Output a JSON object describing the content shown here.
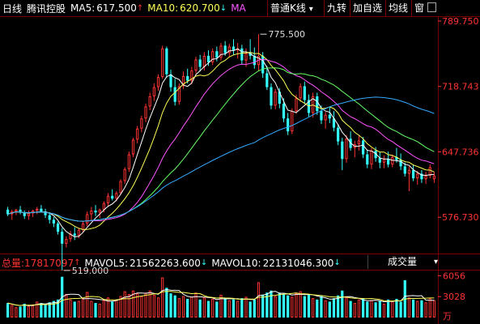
{
  "header": {
    "period": "日线",
    "stock_name": "腾讯控股",
    "ma5_label": "MA5:",
    "ma5_value": "617.500",
    "ma5_arrow": "↑",
    "ma10_label": "MA10:",
    "ma10_value": "620.700",
    "ma10_arrow": "↓",
    "ma_more": "MA"
  },
  "toolbar": {
    "kline_type": "普通K线",
    "kline_arrow": "▾",
    "nine_turn": "九转",
    "add_watch": "加自选",
    "avg_line": "均线",
    "window": "窗"
  },
  "volume_header": {
    "total_label": "总量:",
    "total_value": "17817097",
    "total_arrow": "↑",
    "mavol5_label": "MAVOL5:",
    "mavol5_value": "21562263.600",
    "mavol5_arrow": "↓",
    "mavol10_label": "MAVOL10:",
    "mavol10_value": "22131046.300",
    "mavol10_arrow": "↓",
    "indicator_select": "成交量",
    "indicator_arrow": "▾"
  },
  "colors": {
    "up": "#ff3333",
    "down": "#33ffff",
    "axis_text": "#ff3333",
    "ma5": "#ffffff",
    "ma10": "#ffff55",
    "ma20": "#ff55ff",
    "ma30": "#66ff66",
    "ma60": "#33aaff",
    "grid": "#7a0000"
  },
  "chart_data": {
    "type": "candlestick",
    "y_ticks": [
      "789.750",
      "718.743",
      "647.736",
      "576.730"
    ],
    "ylim": [
      540.0,
      795.0
    ],
    "volume_ticks": [
      "6056",
      "3028"
    ],
    "volume_unit": "万",
    "volume_ylim": [
      0,
      6800
    ],
    "annotations": [
      {
        "text": "775.500",
        "index": 60,
        "price": 775.5
      },
      {
        "text": "519.000",
        "index": 13,
        "price": 519.0
      }
    ],
    "candles": [
      [
        585,
        588,
        578,
        580
      ],
      [
        580,
        585,
        574,
        583
      ],
      [
        583,
        586,
        579,
        585
      ],
      [
        585,
        589,
        580,
        582
      ],
      [
        582,
        584,
        575,
        578
      ],
      [
        578,
        584,
        574,
        581
      ],
      [
        581,
        585,
        577,
        584
      ],
      [
        584,
        588,
        580,
        586
      ],
      [
        586,
        590,
        582,
        583
      ],
      [
        583,
        586,
        576,
        579
      ],
      [
        579,
        582,
        570,
        574
      ],
      [
        574,
        577,
        566,
        570
      ],
      [
        570,
        572,
        558,
        561
      ],
      [
        561,
        565,
        519,
        548
      ],
      [
        548,
        556,
        544,
        553
      ],
      [
        553,
        562,
        550,
        559
      ],
      [
        559,
        566,
        552,
        557
      ],
      [
        557,
        565,
        554,
        563
      ],
      [
        563,
        572,
        560,
        570
      ],
      [
        570,
        583,
        567,
        580
      ],
      [
        580,
        588,
        574,
        584
      ],
      [
        584,
        590,
        578,
        582
      ],
      [
        582,
        586,
        576,
        585
      ],
      [
        585,
        594,
        582,
        592
      ],
      [
        592,
        603,
        589,
        600
      ],
      [
        600,
        607,
        595,
        597
      ],
      [
        597,
        605,
        594,
        603
      ],
      [
        603,
        618,
        601,
        616
      ],
      [
        616,
        631,
        613,
        629
      ],
      [
        629,
        648,
        626,
        645
      ],
      [
        645,
        663,
        642,
        661
      ],
      [
        661,
        676,
        657,
        673
      ],
      [
        673,
        687,
        669,
        684
      ],
      [
        684,
        700,
        680,
        697
      ],
      [
        697,
        712,
        693,
        708
      ],
      [
        708,
        722,
        703,
        718
      ],
      [
        718,
        732,
        714,
        729
      ],
      [
        729,
        763,
        727,
        760
      ],
      [
        760,
        762,
        728,
        732
      ],
      [
        732,
        737,
        713,
        718
      ],
      [
        718,
        727,
        698,
        702
      ],
      [
        702,
        722,
        699,
        719
      ],
      [
        719,
        735,
        716,
        730
      ],
      [
        730,
        738,
        722,
        725
      ],
      [
        725,
        740,
        721,
        736
      ],
      [
        736,
        751,
        733,
        748
      ],
      [
        748,
        753,
        735,
        740
      ],
      [
        740,
        756,
        736,
        752
      ],
      [
        752,
        758,
        741,
        745
      ],
      [
        745,
        760,
        742,
        757
      ],
      [
        757,
        762,
        746,
        750
      ],
      [
        750,
        766,
        747,
        763
      ],
      [
        763,
        768,
        752,
        755
      ],
      [
        755,
        765,
        751,
        762
      ],
      [
        762,
        770,
        753,
        758
      ],
      [
        758,
        766,
        749,
        760
      ],
      [
        760,
        764,
        743,
        747
      ],
      [
        747,
        760,
        740,
        755
      ],
      [
        755,
        770,
        748,
        752
      ],
      [
        752,
        761,
        738,
        742
      ],
      [
        742,
        775.5,
        736,
        752
      ],
      [
        752,
        756,
        728,
        733
      ],
      [
        733,
        741,
        715,
        718
      ],
      [
        718,
        722,
        694,
        698
      ],
      [
        698,
        716,
        694,
        713
      ],
      [
        713,
        717,
        695,
        700
      ],
      [
        700,
        706,
        680,
        684
      ],
      [
        684,
        690,
        666,
        670
      ],
      [
        670,
        695,
        667,
        692
      ],
      [
        692,
        710,
        689,
        706
      ],
      [
        706,
        722,
        702,
        719
      ],
      [
        719,
        724,
        700,
        704
      ],
      [
        704,
        710,
        686,
        690
      ],
      [
        690,
        712,
        685,
        708
      ],
      [
        708,
        712,
        688,
        692
      ],
      [
        692,
        698,
        678,
        682
      ],
      [
        682,
        691,
        673,
        688
      ],
      [
        688,
        696,
        679,
        684
      ],
      [
        684,
        692,
        670,
        674
      ],
      [
        674,
        678,
        655,
        659
      ],
      [
        659,
        663,
        628,
        640
      ],
      [
        640,
        666,
        636,
        662
      ],
      [
        662,
        670,
        649,
        652
      ],
      [
        652,
        660,
        642,
        656
      ],
      [
        656,
        666,
        649,
        660
      ],
      [
        660,
        664,
        641,
        645
      ],
      [
        645,
        650,
        630,
        634
      ],
      [
        634,
        652,
        629,
        649
      ],
      [
        649,
        653,
        637,
        641
      ],
      [
        641,
        648,
        630,
        636
      ],
      [
        636,
        644,
        630,
        640
      ],
      [
        640,
        648,
        631,
        634
      ],
      [
        634,
        645,
        631,
        642
      ],
      [
        642,
        652,
        636,
        639
      ],
      [
        639,
        646,
        628,
        632
      ],
      [
        632,
        636,
        621,
        624
      ],
      [
        624,
        632,
        605,
        628
      ],
      [
        628,
        634,
        616,
        619
      ],
      [
        619,
        627,
        612,
        624
      ],
      [
        624,
        628,
        614,
        618
      ],
      [
        618,
        626,
        613,
        622
      ],
      [
        622,
        634,
        619,
        631
      ],
      [
        618,
        626,
        614,
        622
      ]
    ],
    "volumes": [
      2100,
      1800,
      1500,
      1600,
      2000,
      1700,
      1900,
      2300,
      2100,
      1800,
      2200,
      2400,
      2600,
      5900,
      3400,
      2600,
      2300,
      2400,
      2800,
      3700,
      2400,
      2100,
      2000,
      2500,
      2900,
      2300,
      2600,
      3100,
      3800,
      3400,
      3900,
      3500,
      3100,
      3600,
      3900,
      3300,
      2900,
      5800,
      4300,
      3500,
      3200,
      2800,
      3100,
      2700,
      3000,
      3600,
      2600,
      2900,
      2400,
      2700,
      2300,
      3300,
      2800,
      2500,
      2600,
      2400,
      2800,
      3000,
      2300,
      2600,
      5100,
      3300,
      3600,
      3900,
      3100,
      3600,
      3400,
      3200,
      3000,
      3500,
      3800,
      3100,
      3300,
      2800,
      2600,
      3100,
      2500,
      2300,
      2800,
      3200,
      3900,
      2900,
      2400,
      2100,
      2600,
      2800,
      2300,
      2500,
      2200,
      2400,
      2000,
      2600,
      2400,
      2700,
      2300,
      5400,
      2900,
      2600,
      2400,
      2500,
      2200,
      2800,
      2500
    ],
    "ma_series": [
      {
        "name": "MA5",
        "color": "#ffffff",
        "period": 5
      },
      {
        "name": "MA10",
        "color": "#ffff55",
        "period": 10
      },
      {
        "name": "",
        "color": "#ff55ff",
        "period": 20
      },
      {
        "name": "",
        "color": "#66ff66",
        "period": 30
      },
      {
        "name": "",
        "color": "#33aaff",
        "period": 60
      }
    ],
    "volume_ma_series": [
      {
        "name": "MAVOL5",
        "color": "#ffffff",
        "period": 5
      },
      {
        "name": "MAVOL10",
        "color": "#ffff55",
        "period": 10
      }
    ]
  }
}
